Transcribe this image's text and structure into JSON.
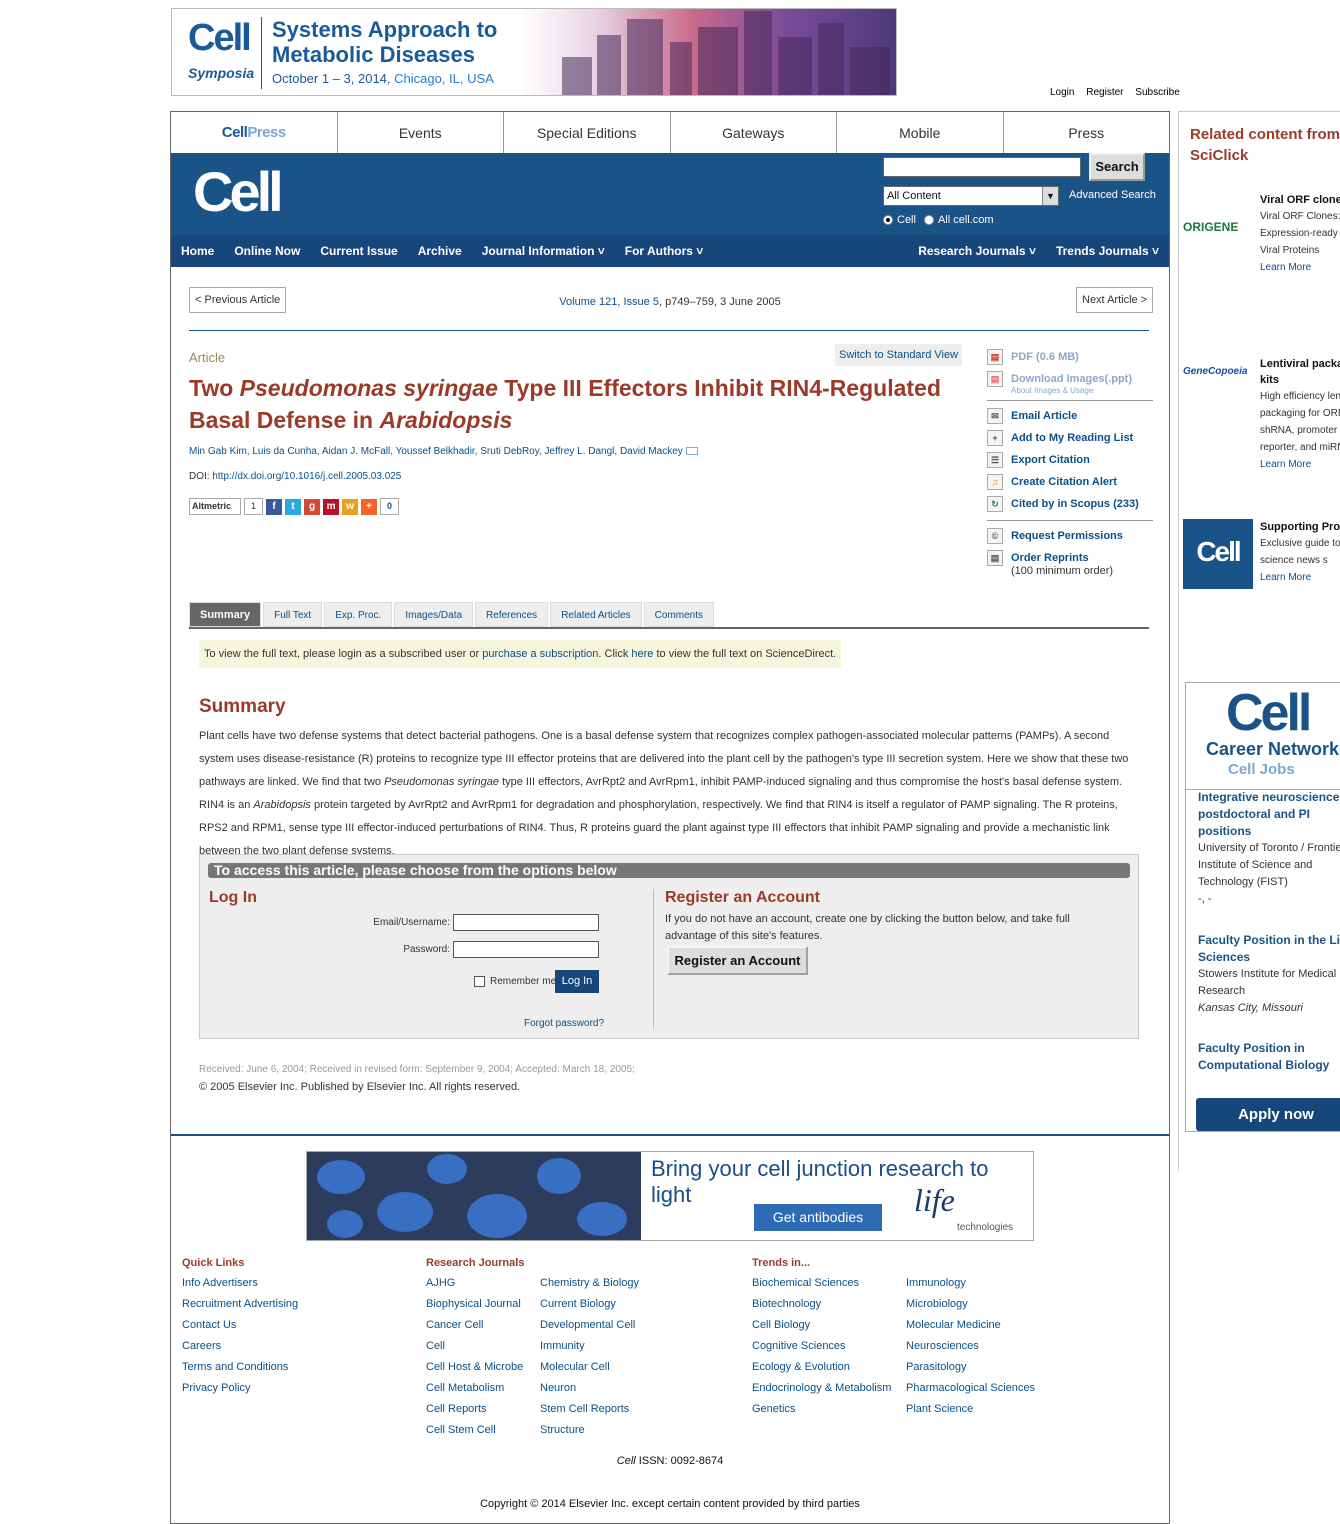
{
  "banner": {
    "brand": "Cell",
    "brand_sub": "Symposia",
    "title": "Systems Approach to Metabolic Diseases",
    "dates": "October 1 – 3, 2014, ",
    "location": "Chicago, IL, USA"
  },
  "top_links": [
    "Login",
    "Register",
    "Subscribe"
  ],
  "top_nav": {
    "cellpress_a": "Cell",
    "cellpress_b": "Press",
    "items": [
      "Events",
      "Special Editions",
      "Gateways",
      "Mobile",
      "Press"
    ]
  },
  "header": {
    "logo": "Cell",
    "search_button": "Search",
    "search_value": "",
    "select_value": "All Content",
    "advanced_search": "Advanced Search",
    "radio_cell": "Cell",
    "radio_all": "All cell.com"
  },
  "main_nav": {
    "left": [
      "Home",
      "Online Now",
      "Current Issue",
      "Archive",
      "Journal Information ˅",
      "For Authors ˅"
    ],
    "right": [
      "Research Journals ˅",
      "Trends Journals ˅"
    ]
  },
  "article_nav": {
    "prev": "< Previous Article",
    "next": "Next Article >",
    "volume_link": "Volume 121, Issue 5",
    "volume_rest": ", p749–759, 3 June 2005"
  },
  "article": {
    "type": "Article",
    "switch_view": "Switch to Standard View",
    "title_1": "Two ",
    "title_2": "Pseudomonas syringae",
    "title_3": " Type III Effectors Inhibit RIN4-Regulated Basal Defense in ",
    "title_4": "Arabidopsis",
    "authors": "Min Gab Kim, Luis da Cunha, Aidan J. McFall, Youssef Belkhadir, Sruti DebRoy, Jeffrey L. Dangl, David Mackey",
    "doi_label": "DOI: ",
    "doi_link": "http://dx.doi.org/10.1016/j.cell.2005.03.025",
    "altmetric": "Altmetric",
    "altmetric_count": "1",
    "share_count": "0"
  },
  "tools": {
    "pdf": "PDF (0.6 MB)",
    "download_images": "Download Images(.ppt)",
    "about_images": "About Images & Usage",
    "email": "Email Article",
    "reading_list": "Add to My Reading List",
    "export_citation": "Export Citation",
    "citation_alert": "Create Citation Alert",
    "cited_by": "Cited by in Scopus (233)",
    "permissions": "Request Permissions",
    "reprints": "Order Reprints",
    "reprints_note": "(100 minimum order)"
  },
  "tabs": [
    "Summary",
    "Full Text",
    "Exp. Proc.",
    "Images/Data",
    "References",
    "Related Articles",
    "Comments"
  ],
  "notice": {
    "a": "To view the full text, please login as a subscribed user or ",
    "link1": "purchase a subscription",
    "b": ". Click ",
    "link2": "here",
    "c": " to view the full text on ScienceDirect."
  },
  "summary": {
    "heading": "Summary",
    "p1": "Plant cells have two defense systems that detect bacterial pathogens. One is a basal defense system that recognizes complex pathogen-associated molecular patterns (PAMPs). A second system uses disease-resistance (R) proteins to recognize type III effector proteins that are delivered into the plant cell by the pathogen's type III secretion system. Here we show that these two pathways are linked. We find that two ",
    "p1_i": "Pseudomonas syringae",
    "p2": " type III effectors, AvrRpt2 and AvrRpm1, inhibit PAMP-induced signaling and thus compromise the host's basal defense system. RIN4 is an ",
    "p2_i": "Arabidopsis",
    "p3": " protein targeted by AvrRpt2 and AvrRpm1 for degradation and phosphorylation, respectively. We find that RIN4 is itself a regulator of PAMP signaling. The R proteins, RPS2 and RPM1, sense type III effector-induced perturbations of RIN4. Thus, R proteins guard the plant against type III effectors that inhibit PAMP signaling and provide a mechanistic link between the two plant defense systems."
  },
  "access": {
    "heading": "To access this article, please choose from the options below",
    "login_heading": "Log In",
    "email_label": "Email/Username:",
    "password_label": "Password:",
    "remember": "Remember me",
    "login_button": "Log In",
    "forgot": "Forgot password?",
    "register_heading": "Register an Account",
    "register_text": "If you do not have an account, create one by clicking the button below, and take full advantage of this site's features.",
    "register_button": "Register an Account"
  },
  "dates": "Received: June 6, 2004; Received in revised form: September 9, 2004; Accepted: March 18, 2005;",
  "copyright": "© 2005 Elsevier Inc. Published by Elsevier Inc. All rights reserved.",
  "ad": {
    "headline": "Bring your cell junction research to light",
    "button": "Get antibodies",
    "brand": "life",
    "brand_sub": "technologies"
  },
  "footer": {
    "quick_links_h": "Quick Links",
    "quick_links": [
      "Info Advertisers",
      "Recruitment Advertising",
      "Contact Us",
      "Careers",
      "Terms and Conditions",
      "Privacy Policy"
    ],
    "research_h": "Research Journals",
    "research_col1": [
      "AJHG",
      "Biophysical Journal",
      "Cancer Cell",
      "Cell",
      "Cell Host & Microbe",
      "Cell Metabolism",
      "Cell Reports",
      "Cell Stem Cell"
    ],
    "research_col2": [
      "Chemistry & Biology",
      "Current Biology",
      "Developmental Cell",
      "Immunity",
      "Molecular Cell",
      "Neuron",
      "Stem Cell Reports",
      "Structure"
    ],
    "trends_h": "Trends in...",
    "trends_col1": [
      "Biochemical Sciences",
      "Biotechnology",
      "Cell Biology",
      "Cognitive Sciences",
      "Ecology & Evolution",
      "Endocrinology & Metabolism",
      "Genetics"
    ],
    "trends_col2": [
      "Immunology",
      "Microbiology",
      "Molecular Medicine",
      "Neurosciences",
      "Parasitology",
      "Pharmacological Sciences",
      "Plant Science"
    ],
    "issn_journal": "Cell",
    "issn": " ISSN: 0092-8674",
    "copyright": "Copyright © 2014 Elsevier Inc. except certain content provided by third parties"
  },
  "sidebar": {
    "heading": "Related content from SciClick",
    "items": [
      {
        "logo": "ORIGENE",
        "title": "Viral ORF clones",
        "text": "Viral ORF Clones: Expression-ready for Viral Proteins",
        "link": "Learn More"
      },
      {
        "logo": "GeneCopoeia",
        "title": "Lentiviral packaging kits",
        "text": "High efficiency lentiviral packaging for ORF, shRNA, promoter reporter, and miRNA",
        "link": "Learn More"
      },
      {
        "logo": "Cell",
        "title": "Supporting Products",
        "text": "Exclusive guide to life science news s",
        "link": "Learn More"
      }
    ],
    "career": {
      "logo": "Cell",
      "network": "Career Network",
      "jobs": "Cell Jobs",
      "jobs_list": [
        {
          "title": "Integrative neuroscience postdoctoral and PI positions",
          "org": "University of Toronto / Frontiers Institute of Science and Technology (FIST)",
          "loc": "-, -"
        },
        {
          "title": "Faculty Position in the Life Sciences",
          "org": "Stowers Institute for Medical Research",
          "loc": "Kansas City, Missouri"
        },
        {
          "title": "Faculty Position in Computational Biology",
          "org": "",
          "loc": ""
        }
      ],
      "apply": "Apply now"
    }
  }
}
